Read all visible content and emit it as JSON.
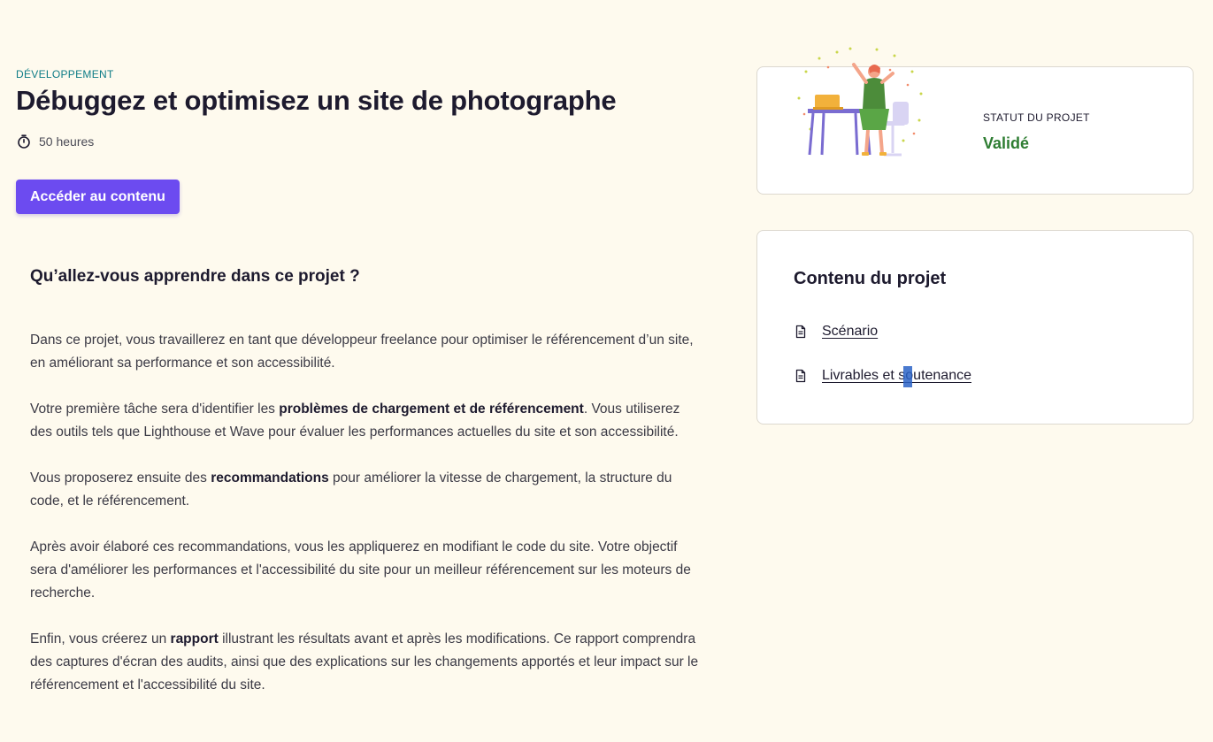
{
  "project": {
    "category": "DÉVELOPPEMENT",
    "title": "Débuggez et optimisez un site de photographe",
    "duration": "50 heures",
    "cta_label": "Accéder au contenu"
  },
  "learn": {
    "heading": "Qu’allez-vous apprendre dans ce projet ?",
    "p1": "Dans ce projet, vous travaillerez en tant que développeur freelance pour optimiser le référencement d’un site, en améliorant sa performance et son accessibilité.",
    "p2_before": "Votre première tâche sera d'identifier les ",
    "p2_bold": "problèmes de chargement et de référencement",
    "p2_after": ". Vous utiliserez des outils tels que Lighthouse et Wave pour évaluer les performances actuelles du site et son accessibilité.",
    "p3_before": "Vous proposerez ensuite des ",
    "p3_bold": "recommandations",
    "p3_after": " pour améliorer la vitesse de chargement, la structure du code, et le référencement.",
    "p4": "Après avoir élaboré ces recommandations, vous les appliquerez en modifiant le code du site. Votre objectif sera d'améliorer les performances et l'accessibilité du site pour un meilleur référencement sur les moteurs de recherche.",
    "p5_before": "Enfin, vous créerez un ",
    "p5_bold": "rapport",
    "p5_after": " illustrant les résultats avant et après les modifications. Ce rapport comprendra des captures d'écran des audits, ainsi que des explications sur les changements apportés et leur impact sur le référencement et l'accessibilité du site."
  },
  "status": {
    "label": "STATUT DU PROJET",
    "value": "Validé",
    "value_color": "#2e7d32"
  },
  "contents": {
    "heading": "Contenu du projet",
    "items": [
      {
        "label": "Scénario",
        "icon": "document-icon"
      },
      {
        "label": "Livrables et soutenance",
        "icon": "document-icon"
      }
    ]
  },
  "colors": {
    "accent": "#6c4bf0",
    "category": "#0e7c86",
    "background": "#fefaee"
  }
}
